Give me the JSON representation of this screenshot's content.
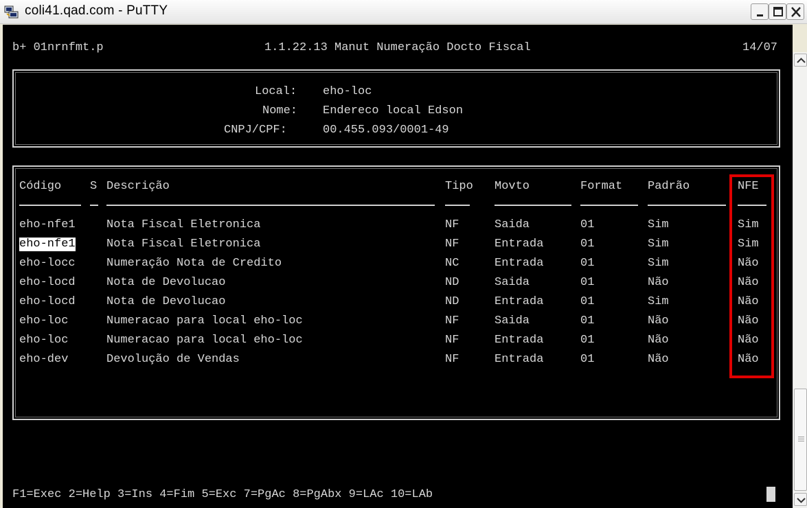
{
  "window": {
    "title": "coli41.qad.com - PuTTY",
    "icon": "putty-icon",
    "controls": [
      "minimize-icon",
      "maximize-icon",
      "close-icon"
    ]
  },
  "header": {
    "program": "b+ 01nrnfmt.p",
    "menu_title": "1.1.22.13 Manut Numeração Docto Fiscal",
    "date": "14/07"
  },
  "info": {
    "local_label": "Local:",
    "local_value": "eho-loc",
    "nome_label": "Nome:",
    "nome_value": "Endereco local Edson",
    "cnpj_label": "CNPJ/CPF:",
    "cnpj_value": "00.455.093/0001-49"
  },
  "table": {
    "columns": [
      "Código",
      "S",
      "Descrição",
      "Tipo",
      "Movto",
      "Format",
      "Padrão",
      "NFE"
    ],
    "rows": [
      {
        "codigo": "eho-nfe1",
        "descricao": "Nota Fiscal Eletronica",
        "tipo": "NF",
        "movto": "Saida",
        "format": "01",
        "padrao": "Sim",
        "nfe": "Sim"
      },
      {
        "codigo": "eho-nfe1",
        "descricao": "Nota Fiscal Eletronica",
        "tipo": "NF",
        "movto": "Entrada",
        "format": "01",
        "padrao": "Sim",
        "nfe": "Sim",
        "selected": true
      },
      {
        "codigo": "eho-locc",
        "descricao": "Numeração Nota de Credito",
        "tipo": "NC",
        "movto": "Entrada",
        "format": "01",
        "padrao": "Sim",
        "nfe": "Não"
      },
      {
        "codigo": "eho-locd",
        "descricao": "Nota de Devolucao",
        "tipo": "ND",
        "movto": "Saida",
        "format": "01",
        "padrao": "Não",
        "nfe": "Não"
      },
      {
        "codigo": "eho-locd",
        "descricao": "Nota de Devolucao",
        "tipo": "ND",
        "movto": "Entrada",
        "format": "01",
        "padrao": "Sim",
        "nfe": "Não"
      },
      {
        "codigo": "eho-loc",
        "descricao": "Numeracao para local eho-loc",
        "tipo": "NF",
        "movto": "Saida",
        "format": "01",
        "padrao": "Não",
        "nfe": "Não"
      },
      {
        "codigo": "eho-loc",
        "descricao": "Numeracao para local eho-loc",
        "tipo": "NF",
        "movto": "Entrada",
        "format": "01",
        "padrao": "Não",
        "nfe": "Não"
      },
      {
        "codigo": "eho-dev",
        "descricao": "Devolução de Vendas",
        "tipo": "NF",
        "movto": "Entrada",
        "format": "01",
        "padrao": "Não",
        "nfe": "Não"
      }
    ]
  },
  "footer": {
    "keys": "F1=Exec 2=Help 3=Ins 4=Fim 5=Exc 7=PgAc 8=PgAbx 9=LAc 10=LAb"
  },
  "colors": {
    "terminal_bg": "#000000",
    "terminal_fg": "#d8d8d8",
    "highlight_frame": "#e00000"
  }
}
